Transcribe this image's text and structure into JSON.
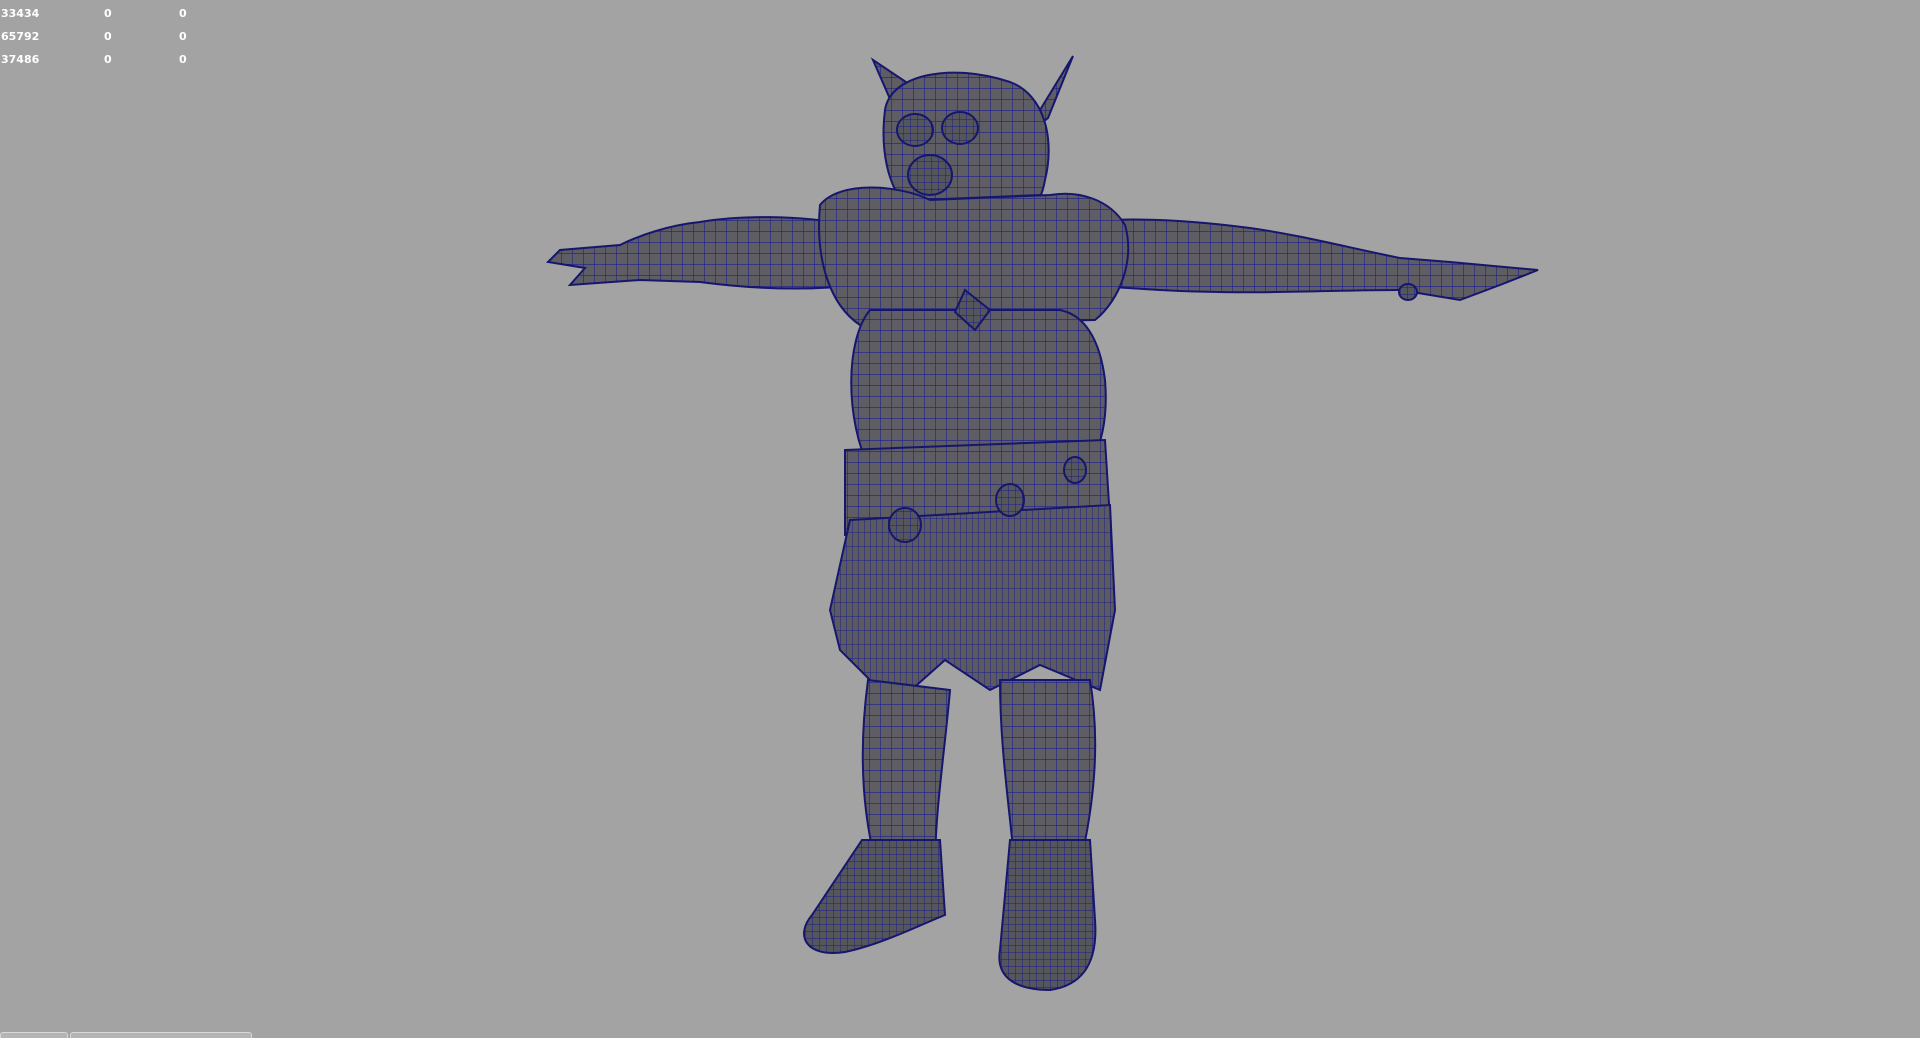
{
  "viewport": {
    "background": "#a3a3a3",
    "wire_color": "#1f1f8c",
    "surface_color": "#5d5d63"
  },
  "hud": {
    "rows": [
      {
        "a": "33434",
        "b": "0",
        "c": "0"
      },
      {
        "a": "65792",
        "b": "0",
        "c": "0"
      },
      {
        "a": "37486",
        "b": "0",
        "c": "0"
      }
    ]
  },
  "model": {
    "icon": "goblin-wireframe-mesh"
  }
}
